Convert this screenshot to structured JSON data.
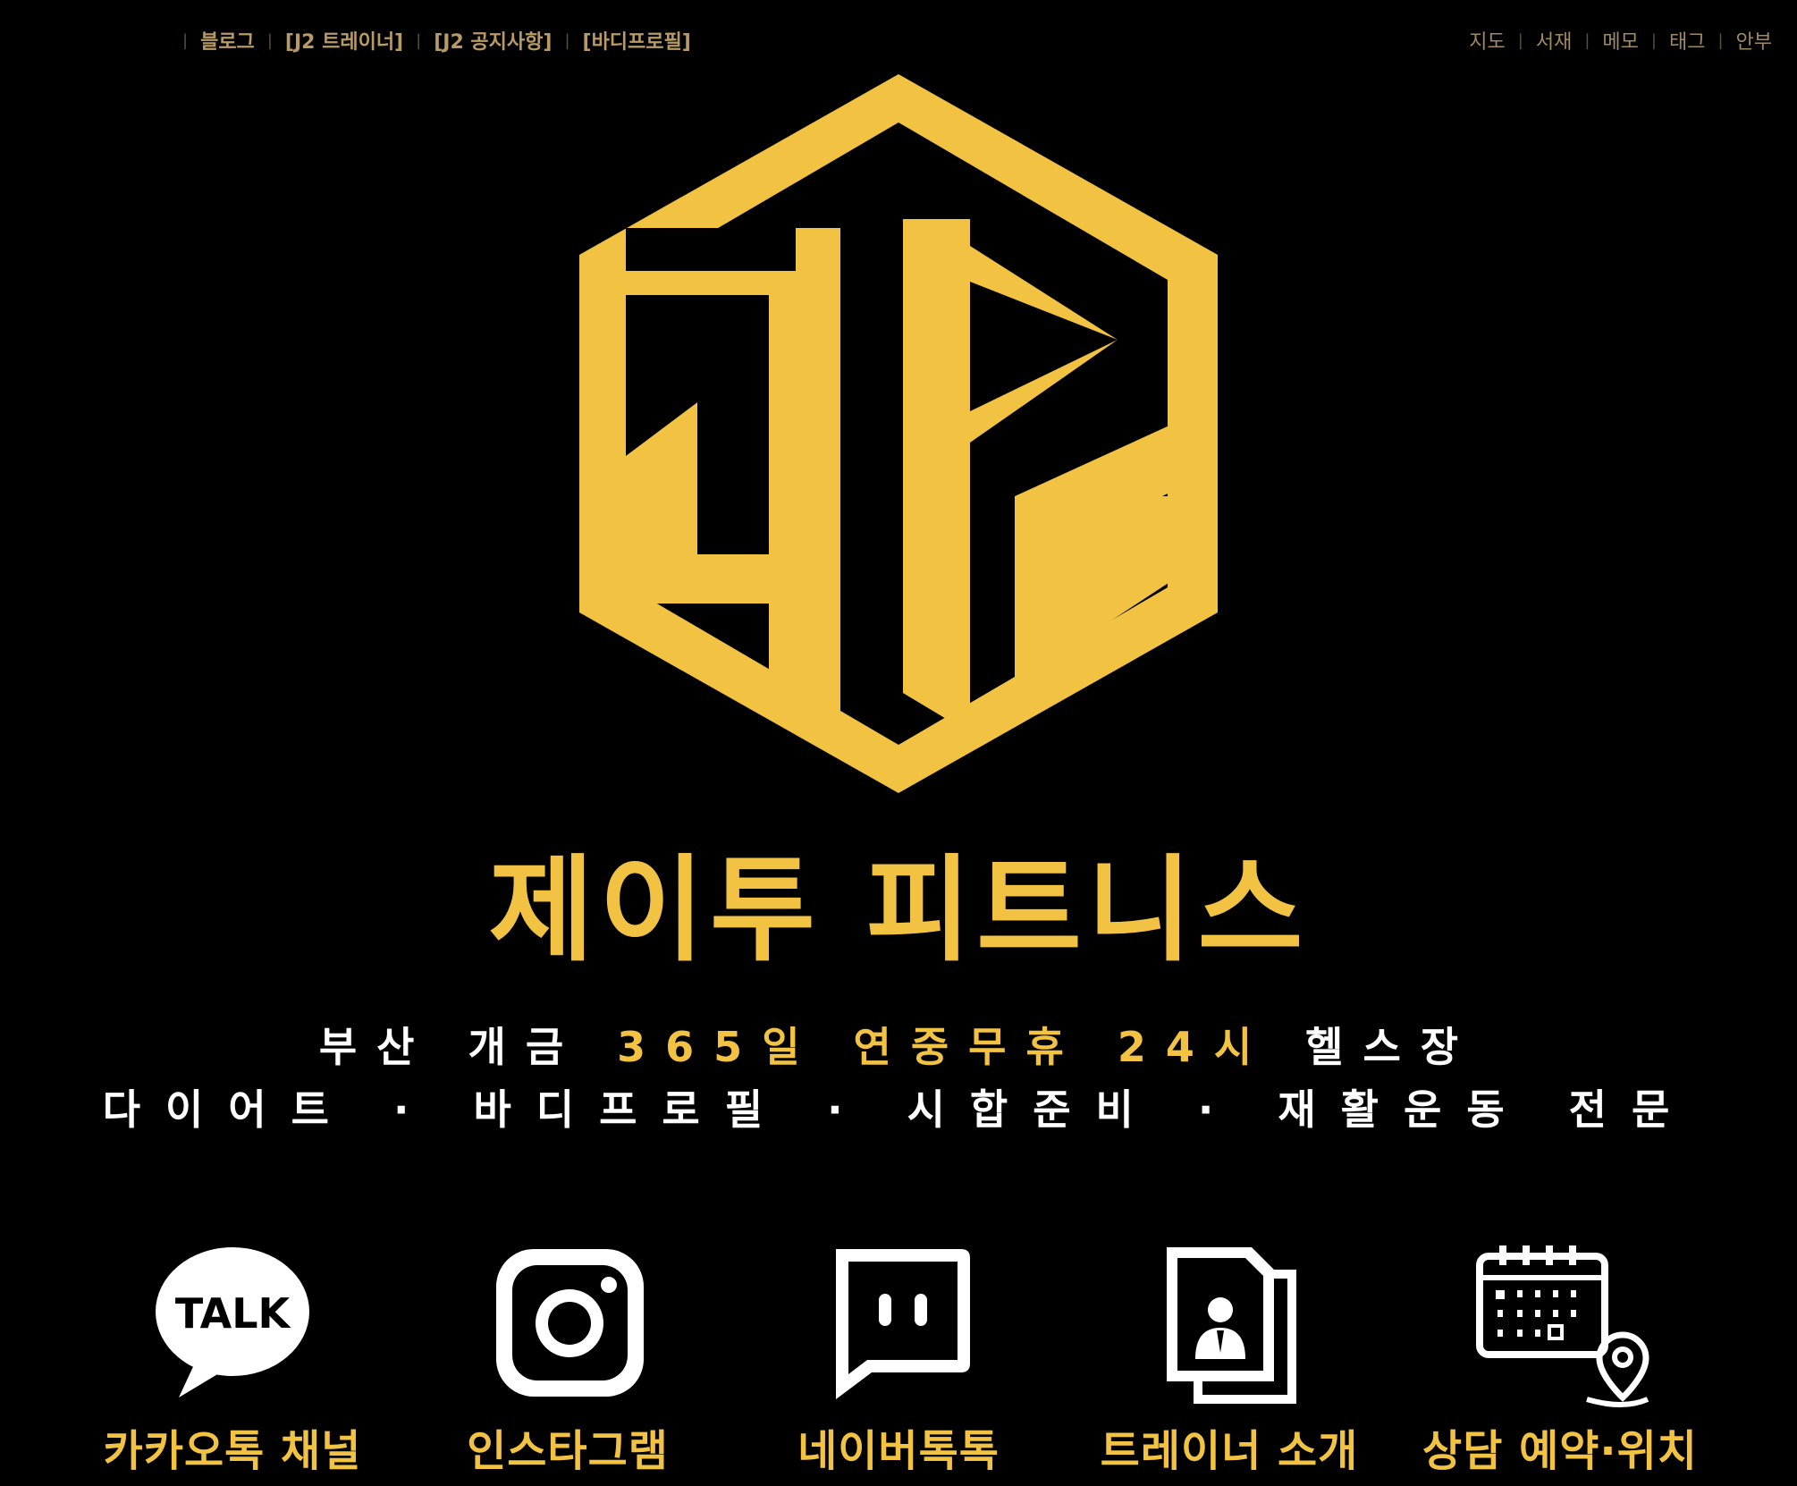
{
  "topnav": {
    "left": [
      "블로그",
      "[J2 트레이너]",
      "[J2 공지사항]",
      "[바디프로필]"
    ],
    "right": [
      "지도",
      "서재",
      "메모",
      "태그",
      "안부"
    ]
  },
  "hero": {
    "brand_name": "제이투 피트니스",
    "tagline_1_pre": "부산 개금 ",
    "tagline_1_hl": "365일 연중무휴 24시",
    "tagline_1_post": " 헬스장",
    "tagline_2": "다이어트 · 바디프로필 · 시합준비 · 재활운동 전문"
  },
  "quick_links": [
    {
      "label": "카카오톡 채널",
      "icon": "kakaotalk-icon",
      "icon_text": "TALK"
    },
    {
      "label": "인스타그램",
      "icon": "instagram-icon"
    },
    {
      "label": "네이버톡톡",
      "icon": "naver-talktalk-icon"
    },
    {
      "label": "트레이너 소개",
      "icon": "profile-document-icon"
    },
    {
      "label": "상담 예약·위치",
      "icon": "calendar-location-icon"
    }
  ],
  "colors": {
    "accent": "#f2c343",
    "background": "#000000",
    "nav_text": "#b89a66"
  }
}
